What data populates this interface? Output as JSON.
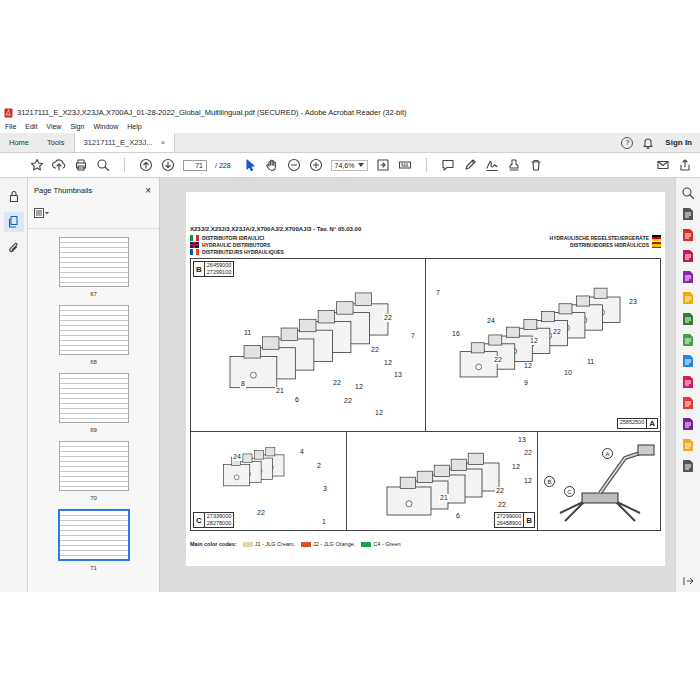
{
  "window": {
    "title": "31217111_E_X23J,X23JA,X700AJ_01-28-2022_Global_Multilingual.pdf (SECURED) - Adobe Acrobat Reader (32-bit)"
  },
  "menu": [
    "File",
    "Edit",
    "View",
    "Sign",
    "Window",
    "Help"
  ],
  "tabs": [
    {
      "label": "Home",
      "selected": false
    },
    {
      "label": "Tools",
      "selected": false
    },
    {
      "label": "31217111_E_X23J...",
      "selected": true,
      "close": "×"
    }
  ],
  "header_right": {
    "help": "?",
    "sign_in": "Sign In"
  },
  "toolbar": {
    "page": "71",
    "total": "/ 228",
    "zoom": "74,6%",
    "tools": [
      {
        "selected": true
      },
      {
        "selected": false
      }
    ]
  },
  "nav_panels": [
    {
      "selected": false
    },
    {
      "selected": true
    },
    {
      "selected": false
    }
  ],
  "sidebar": {
    "title": "Page Thumbnails",
    "close": "×",
    "thumbnails": [
      {
        "page": "67",
        "selected": false
      },
      {
        "page": "68",
        "selected": false
      },
      {
        "page": "69",
        "selected": false
      },
      {
        "page": "70",
        "selected": false
      },
      {
        "page": "71",
        "selected": true
      }
    ]
  },
  "document": {
    "header": "X23J/2,X23J/3,X23JA/2,X700AJ/2,X700AJ/3 - Tav. N° 05.03.00",
    "titles_left": [
      {
        "text": "DISTRIBUTORI IDRAULICI",
        "kind": "it"
      },
      {
        "text": "HYDRAULIC DISTRIBUTORS",
        "kind": "gb"
      },
      {
        "text": "DISTRIBUTEURS HYDRAULIQUES",
        "kind": "fr"
      }
    ],
    "titles_right": [
      {
        "text": "HYDRAULISCHE REGELSTEUERGERÄTE",
        "kind": "de"
      },
      {
        "text": "DISTRIBUIDORES HIDRÁULICOS",
        "kind": "es"
      }
    ],
    "panels": [
      {
        "letter": "B",
        "codes": [
          "26459000",
          "27299100"
        ],
        "callouts": [
          "22",
          "7",
          "11",
          "22",
          "12",
          "13",
          "8",
          "21",
          "22",
          "12",
          "6",
          "22",
          "12"
        ]
      },
      {
        "letter": "A",
        "codes": [
          "25852500"
        ],
        "callouts": [
          "7",
          "23",
          "16",
          "24",
          "22",
          "12",
          "22",
          "12",
          "9",
          "10",
          "11"
        ]
      },
      {
        "letter": "C",
        "codes": [
          "27339000",
          "28278000"
        ],
        "callouts": [
          "24",
          "4",
          "2",
          "3",
          "22",
          "1"
        ]
      },
      {
        "letter": "B",
        "codes": [
          "27299000",
          "26458900"
        ],
        "callouts": [
          "13",
          "22",
          "12",
          "12",
          "22",
          "21",
          "22",
          "6"
        ]
      }
    ],
    "machine_labels": [
      "A",
      "B",
      "C"
    ],
    "color_codes": {
      "label": "Main color codes:",
      "items": [
        {
          "text": "J1 - JLG Cream,",
          "color": "#e4d2a8"
        },
        {
          "text": "J2 - JLG Orange,",
          "color": "#d9531e"
        },
        {
          "text": "C4 - Green",
          "color": "#1f9e48"
        }
      ]
    }
  }
}
